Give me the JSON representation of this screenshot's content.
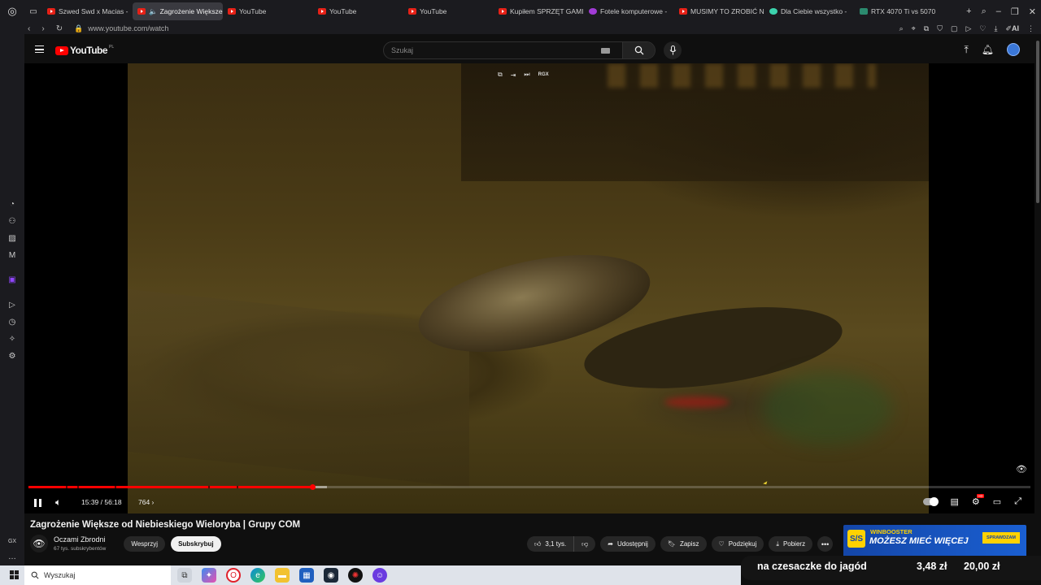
{
  "browser": {
    "tabs": [
      {
        "label": "Szwed Swd x Macias -",
        "icon": "youtube-icon"
      },
      {
        "label": "Zagrożenie Większe",
        "icon": "youtube-icon",
        "active": true
      },
      {
        "label": "YouTube",
        "icon": "youtube-icon"
      },
      {
        "label": "YouTube",
        "icon": "youtube-icon"
      },
      {
        "label": "YouTube",
        "icon": "youtube-icon"
      },
      {
        "label": "Kupiłem SPRZĘT GAMI",
        "icon": "youtube-icon"
      },
      {
        "label": "Fotele komputerowe -",
        "icon": "purple-site-icon"
      },
      {
        "label": "MUSIMY TO ZROBIĆ N",
        "icon": "youtube-icon"
      },
      {
        "label": "Dla Ciebie wszystko -",
        "icon": "green-site-icon"
      },
      {
        "label": "RTX 4070 Ti vs 5070",
        "icon": "teal-site-icon"
      }
    ],
    "url": "www.youtube.com/watch",
    "ai_label": "AI"
  },
  "youtube": {
    "logo_text": "YouTube",
    "region": "PL",
    "search_placeholder": "Szukaj",
    "mini_controls_label": "RGX"
  },
  "player": {
    "time": "15:39 / 56:18",
    "chapter": "764",
    "progress_played_fraction": 0.283,
    "progress_loaded_fraction": 0.298
  },
  "video": {
    "title": "Zagrożenie Większe od Niebieskiego Wieloryba | Grupy COM",
    "channel_name": "Oczami Zbrodni",
    "subscribers": "67 tys. subskrybentów",
    "support_label": "Wesprzyj",
    "subscribe_label": "Subskrybuj",
    "likes": "3,1 tys.",
    "share_label": "Udostępnij",
    "save_label": "Zapisz",
    "thanks_label": "Podziękuj",
    "download_label": "Pobierz"
  },
  "ad": {
    "brand": "WINBOOSTER",
    "slogan": "MOŻESZ MIEĆ WIĘCEJ",
    "cta": "SPRAWDZAM",
    "logo_text": "S/S"
  },
  "overlay": {
    "title": "na czesaczke do jagód",
    "price1": "3,48 zł",
    "price2": "20,00 zł"
  },
  "taskbar": {
    "search_placeholder": "Wyszukaj"
  },
  "sidebar_bottom_label": "GX"
}
